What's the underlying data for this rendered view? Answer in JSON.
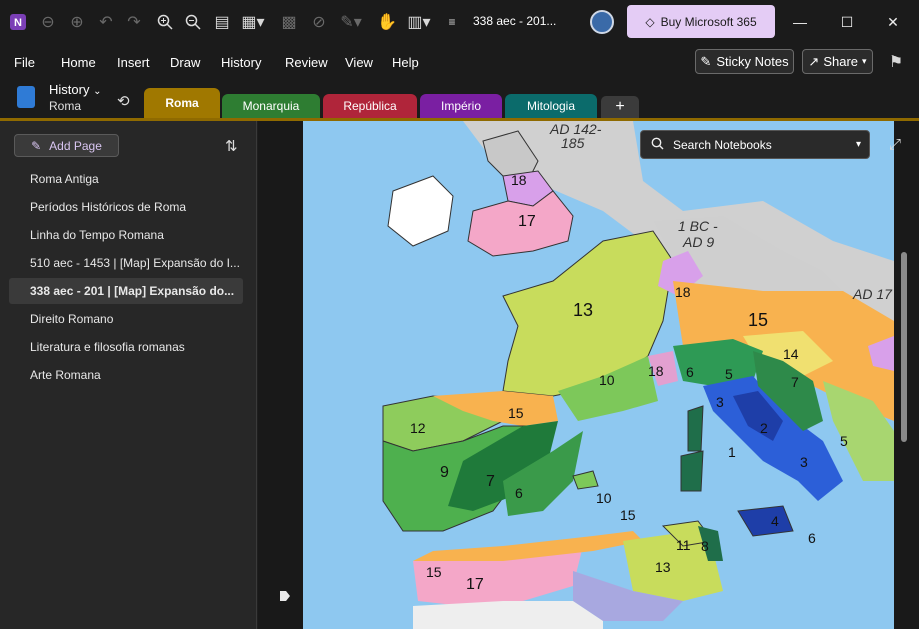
{
  "titlebar": {
    "app_icon": "onenote-icon",
    "doc_title": "338 aec - 201...",
    "buy_label": "Buy Microsoft 365"
  },
  "menu": {
    "items": [
      "File",
      "Home",
      "Insert",
      "Draw",
      "History",
      "Review",
      "View",
      "Help"
    ],
    "sticky_notes": "Sticky Notes",
    "share": "Share"
  },
  "notebook": {
    "name": "History",
    "section": "Roma"
  },
  "tabs": [
    {
      "label": "Roma",
      "color": "#a07800",
      "active": true
    },
    {
      "label": "Monarquia",
      "color": "#2e7d32",
      "active": false
    },
    {
      "label": "República",
      "color": "#b0253a",
      "active": false
    },
    {
      "label": "Império",
      "color": "#7a1fa2",
      "active": false
    },
    {
      "label": "Mitologia",
      "color": "#0b6b6b",
      "active": false
    }
  ],
  "sidebar": {
    "add_page": "Add Page",
    "pages": [
      "Roma Antiga",
      "Períodos Históricos de Roma",
      "Linha do Tempo Romana",
      "510 aec - 1453 | [Map] Expansão do I...",
      "338 aec - 201 | [Map] Expansão do...",
      "Direito Romano",
      "Literatura e filosofia romanas",
      "Arte Romana"
    ],
    "selected_index": 4
  },
  "search": {
    "placeholder": "Search Notebooks"
  },
  "map_labels": {
    "ad142": "AD 142-",
    "ad142b": "185",
    "bc1": "1 BC -",
    "ad9": "AD 9",
    "ad17": "AD 17",
    "n18a": "18",
    "n17a": "17",
    "n13a": "13",
    "n18b": "18",
    "n15a": "15",
    "n14": "14",
    "n18c": "18",
    "n10a": "10",
    "n6a": "6",
    "n5a": "5",
    "n7a": "7",
    "n3a": "3",
    "n2": "2",
    "n1": "1",
    "n3b": "3",
    "n5b": "5",
    "n12": "12",
    "n15b": "15",
    "n9": "9",
    "n7b": "7",
    "n6b": "6",
    "n10b": "10",
    "n15c": "15",
    "n4": "4",
    "n6c": "6",
    "n11": "11",
    "n8": "8",
    "n13b": "13",
    "n15d": "15",
    "n17b": "17"
  }
}
